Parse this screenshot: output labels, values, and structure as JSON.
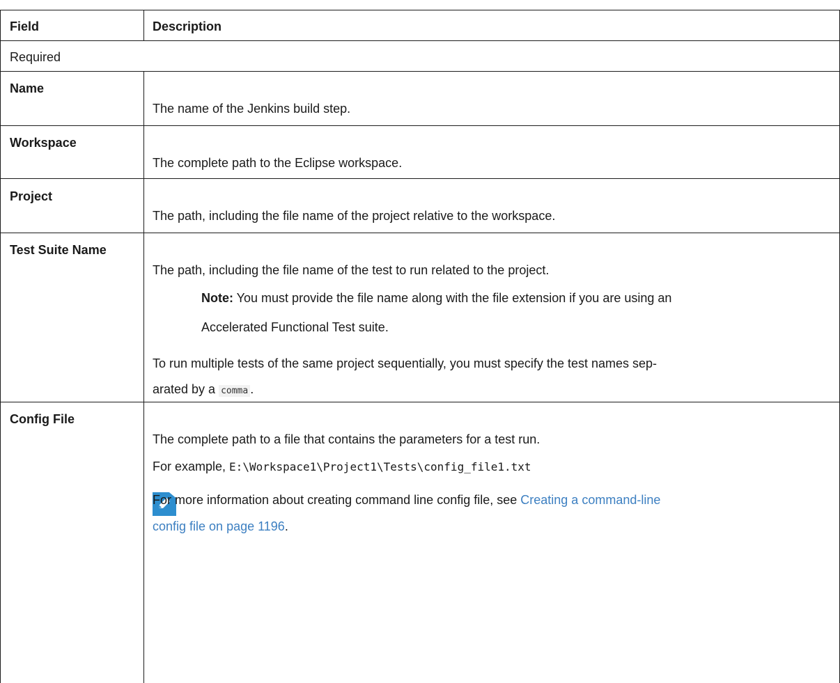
{
  "table": {
    "headers": {
      "field": "Field",
      "description": "Description"
    },
    "section_label": "Required",
    "rows": [
      {
        "field": "Name",
        "description": "The name of the Jenkins build step."
      },
      {
        "field": "Workspace",
        "description": "The complete path to the Eclipse workspace."
      },
      {
        "field": "Project",
        "description": "The path, including the file name of the project relative to the workspace."
      },
      {
        "field": "Test Suite Name",
        "description": "The path, including the file name of the test to run related to the project.",
        "note_label": "Note:",
        "note_line1": " You must provide the file name along with the file extension if you are using an",
        "note_line2": "Accelerated Functional Test suite.",
        "extra_line1": "To run multiple tests of the same project sequentially, you must specify the test names sep-",
        "extra_line2_before": "arated by a ",
        "extra_line2_code": "comma",
        "extra_line2_after": "."
      },
      {
        "field": "Config File",
        "description": "The complete path to a file that contains the parameters for a test run.",
        "example_prefix": "For example, ",
        "example_code": "E:\\Workspace1\\Project1\\Tests\\config_file1.txt",
        "more_info_prefix": "For more information about creating command line config file, see ",
        "link_line1": "Creating a command-line",
        "link_line2": "config file on page 1196",
        "link_suffix": "."
      }
    ]
  },
  "colors": {
    "border": "#1c1c1c",
    "link": "#3c7fc1",
    "note_icon": "#2d8ecf"
  },
  "icons": {
    "note": "pencil-note-icon"
  }
}
